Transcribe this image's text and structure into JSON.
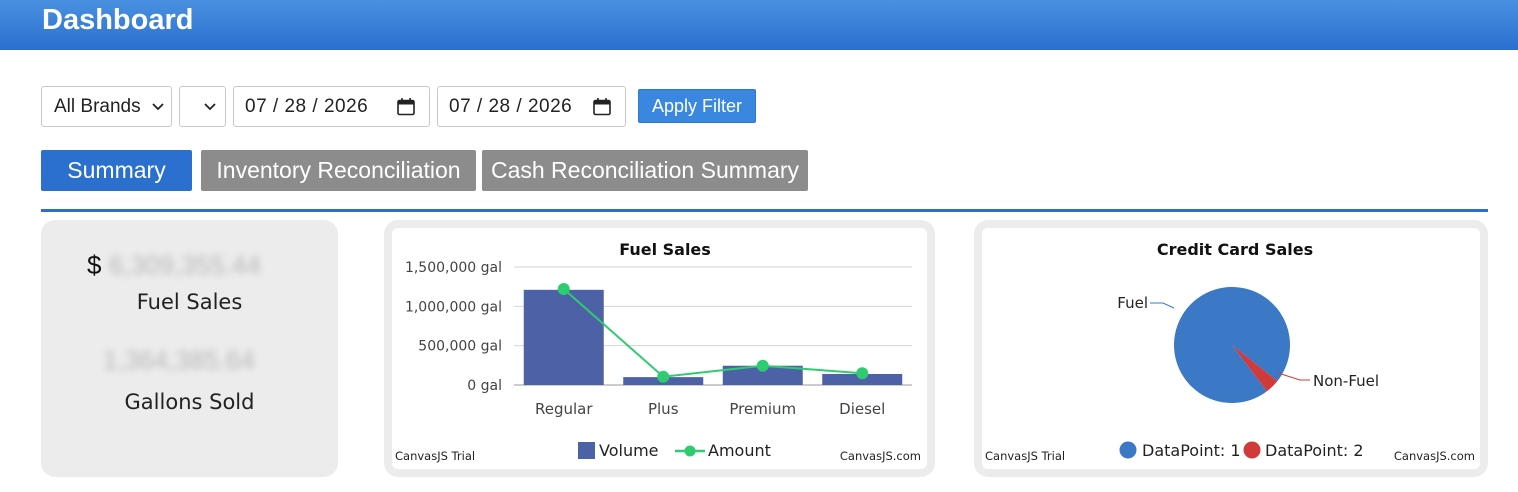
{
  "header": {
    "title": "Dashboard"
  },
  "filters": {
    "brand_select": "All Brands",
    "second_select": "",
    "start_date": "07 / 28 / 2026",
    "end_date": "07 / 28 / 2026",
    "apply_label": "Apply Filter"
  },
  "tabs": [
    {
      "label": "Summary",
      "active": true
    },
    {
      "label": "Inventory Reconciliation",
      "active": false
    },
    {
      "label": "Cash Reconciliation Summary",
      "active": false
    }
  ],
  "summary": {
    "currency_symbol": "$",
    "fuel_sales_value": "6,309,355.44",
    "fuel_sales_label": "Fuel Sales",
    "gallons_value": "1,364,385.64",
    "gallons_label": "Gallons Sold"
  },
  "fuel_chart": {
    "watermark_left": "CanvasJS Trial",
    "watermark_right": "CanvasJS.com"
  },
  "cc_chart": {
    "watermark_left": "CanvasJS Trial",
    "watermark_right": "CanvasJS.com"
  },
  "colors": {
    "header": "#2a6fcf",
    "active_tab": "#2b6fcf",
    "inactive_tab": "#8c8c8c",
    "bar": "#4d62a6",
    "line": "#2ecc71",
    "pie_fuel": "#3b78c6",
    "pie_nonfuel": "#d03a3a"
  },
  "chart_data": [
    {
      "type": "bar",
      "title": "Fuel Sales",
      "categories": [
        "Regular",
        "Plus",
        "Premium",
        "Diesel"
      ],
      "ylim": [
        0,
        1500000
      ],
      "yticks": [
        "0 gal",
        "500,000 gal",
        "1,000,000 gal",
        "1,500,000 gal"
      ],
      "series": [
        {
          "name": "Volume",
          "type": "bar",
          "values": [
            1210000,
            100000,
            245000,
            140000
          ]
        },
        {
          "name": "Amount",
          "type": "line",
          "values": [
            1220000,
            105000,
            245000,
            150000
          ]
        }
      ],
      "legend_position": "bottom",
      "grid": true
    },
    {
      "type": "pie",
      "title": "Credit Card Sales",
      "labels": [
        "Fuel",
        "Non-Fuel"
      ],
      "values": [
        96,
        4
      ],
      "legend": [
        "DataPoint: 1",
        "DataPoint: 2"
      ],
      "legend_position": "bottom"
    }
  ]
}
